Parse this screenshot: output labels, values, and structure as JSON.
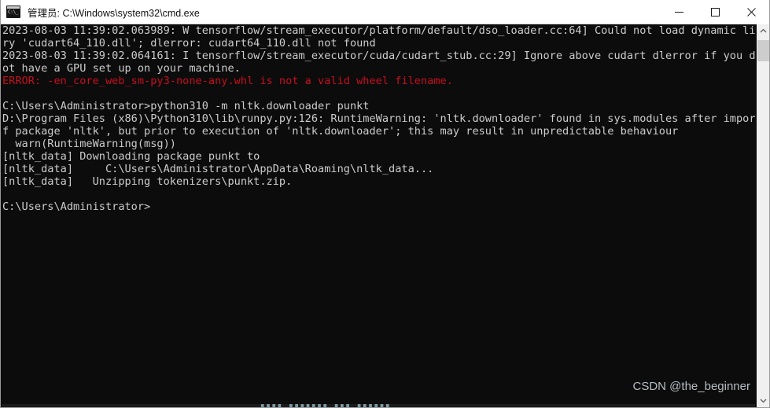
{
  "window": {
    "title": "管理员: C:\\Windows\\system32\\cmd.exe",
    "icon": "console-icon",
    "controls": {
      "minimize": "minimize-button",
      "maximize": "maximize-button",
      "close": "close-button"
    },
    "background_color": "#0c0c0c",
    "text_color": "#cccccc",
    "error_color": "#c50f1f"
  },
  "console": {
    "lines": [
      {
        "text": "2023-08-03 11:39:02.063989: W tensorflow/stream_executor/platform/default/dso_loader.cc:64] Could not load dynamic libra",
        "type": "normal"
      },
      {
        "text": "ry 'cudart64_110.dll'; dlerror: cudart64_110.dll not found",
        "type": "normal"
      },
      {
        "text": "2023-08-03 11:39:02.064161: I tensorflow/stream_executor/cuda/cudart_stub.cc:29] Ignore above cudart dlerror if you do n",
        "type": "normal"
      },
      {
        "text": "ot have a GPU set up on your machine.",
        "type": "normal"
      },
      {
        "text": "ERROR: -en_core_web_sm-py3-none-any.whl is not a valid wheel filename.",
        "type": "error"
      },
      {
        "text": "",
        "type": "normal"
      },
      {
        "text": "C:\\Users\\Administrator>python310 -m nltk.downloader punkt",
        "type": "normal"
      },
      {
        "text": "D:\\Program Files (x86)\\Python310\\lib\\runpy.py:126: RuntimeWarning: 'nltk.downloader' found in sys.modules after import o",
        "type": "normal"
      },
      {
        "text": "f package 'nltk', but prior to execution of 'nltk.downloader'; this may result in unpredictable behaviour",
        "type": "normal"
      },
      {
        "text": "  warn(RuntimeWarning(msg))",
        "type": "normal"
      },
      {
        "text": "[nltk_data] Downloading package punkt to",
        "type": "normal"
      },
      {
        "text": "[nltk_data]     C:\\Users\\Administrator\\AppData\\Roaming\\nltk_data...",
        "type": "normal"
      },
      {
        "text": "[nltk_data]   Unzipping tokenizers\\punkt.zip.",
        "type": "normal"
      },
      {
        "text": "",
        "type": "normal"
      },
      {
        "text": "C:\\Users\\Administrator>",
        "type": "normal"
      }
    ]
  },
  "scrollbar": {
    "up_arrow": "scroll-up-icon",
    "down_arrow": "scroll-down-icon",
    "thumb": "scrollbar-thumb"
  },
  "watermark": {
    "text": "CSDN @the_beginner"
  },
  "background_window": {
    "text": "▌▌▌▌ ▌▌▌▌▌▌▌ ▌▌▌ ▌▌▌▌▌▌"
  }
}
